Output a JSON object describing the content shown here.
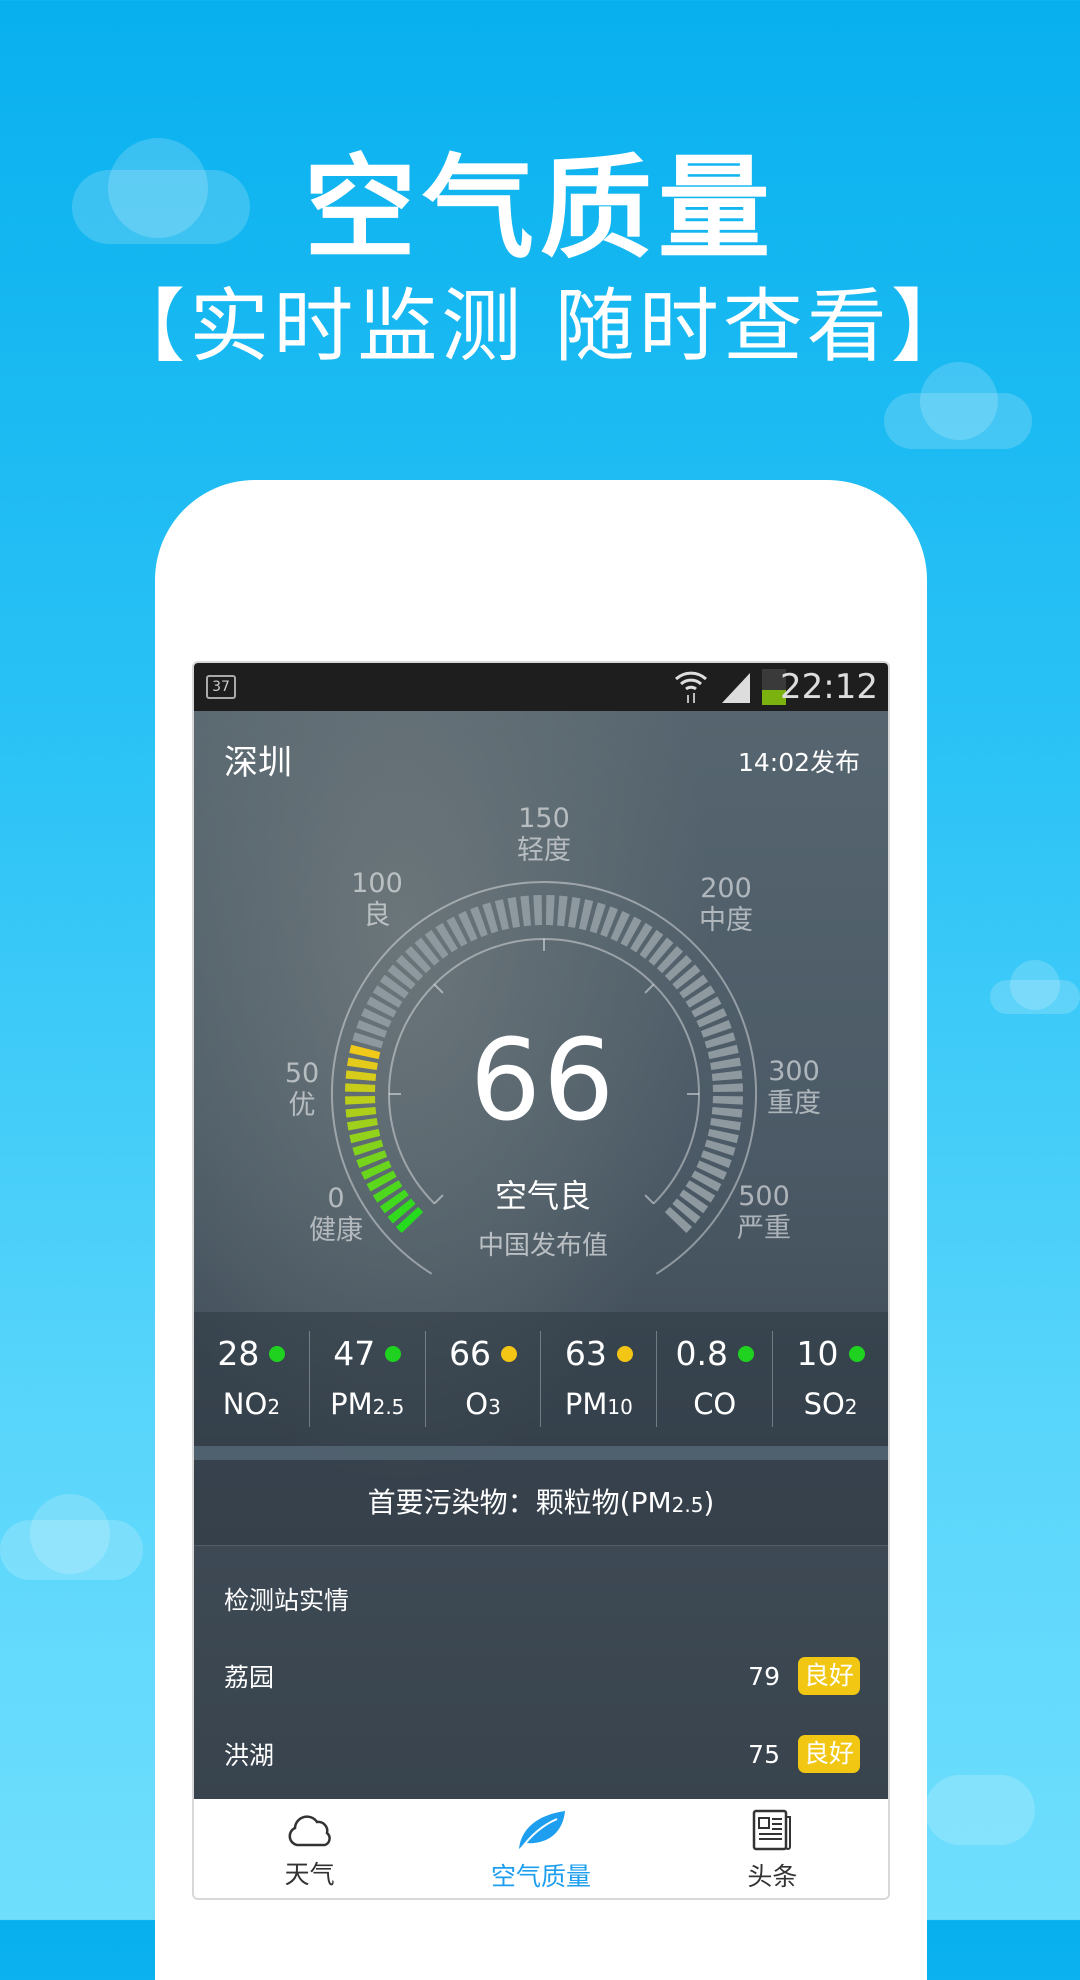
{
  "promo": {
    "title": "空气质量",
    "subtitle": "【实时监测 随时查看】"
  },
  "status_bar": {
    "notification": "37",
    "time": "22:12",
    "icons": [
      "wifi-icon",
      "signal-icon",
      "battery-icon"
    ]
  },
  "header": {
    "city": "深圳",
    "published": "14:02发布"
  },
  "gauge": {
    "value": "66",
    "aqi": 66,
    "level": "空气良",
    "source": "中国发布值",
    "scale": [
      {
        "num": "0",
        "label": "健康"
      },
      {
        "num": "50",
        "label": "优"
      },
      {
        "num": "100",
        "label": "良"
      },
      {
        "num": "150",
        "label": "轻度"
      },
      {
        "num": "200",
        "label": "中度"
      },
      {
        "num": "300",
        "label": "重度"
      },
      {
        "num": "500",
        "label": "严重"
      }
    ],
    "colors": {
      "start": "#1edc1e",
      "end": "#f6c918",
      "empty": "#8e999f"
    }
  },
  "pollutants": [
    {
      "value": "28",
      "name": "NO",
      "sub": "2",
      "color": "#1fd21f"
    },
    {
      "value": "47",
      "name": "PM",
      "sub": "2.5",
      "color": "#1fd21f"
    },
    {
      "value": "66",
      "name": "O",
      "sub": "3",
      "color": "#f3c515"
    },
    {
      "value": "63",
      "name": "PM",
      "sub": "10",
      "color": "#f3c515"
    },
    {
      "value": "0.8",
      "name": "CO",
      "sub": "",
      "color": "#1fd21f"
    },
    {
      "value": "10",
      "name": "SO",
      "sub": "2",
      "color": "#1fd21f"
    }
  ],
  "primary": {
    "label": "首要污染物：颗粒物(PM",
    "sub": "2.5",
    "close": ")"
  },
  "stations": {
    "title": "检测站实情",
    "items": [
      {
        "name": "荔园",
        "value": "79",
        "level": "良好"
      },
      {
        "name": "洪湖",
        "value": "75",
        "level": "良好"
      }
    ]
  },
  "nav": [
    {
      "label": "天气",
      "icon": "cloud-icon",
      "active": false
    },
    {
      "label": "空气质量",
      "icon": "leaf-icon",
      "active": true
    },
    {
      "label": "头条",
      "icon": "newspaper-icon",
      "active": false
    }
  ]
}
